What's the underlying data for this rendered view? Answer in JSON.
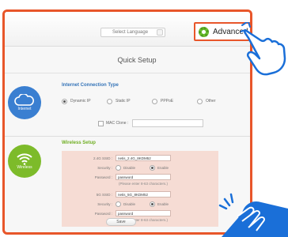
{
  "header": {
    "language_select": "Select Language",
    "advanced_label": "Advanced"
  },
  "page_title": "Quick Setup",
  "internet": {
    "icon_label": "Internet",
    "heading": "Internet Connection Type",
    "options": [
      "Dynamic IP",
      "Static IP",
      "PPPoE",
      "Other"
    ],
    "selected": "Dynamic IP",
    "mac_clone_label": "MAC Clone :"
  },
  "wireless": {
    "icon_label": "Wireless",
    "heading": "Wireless Setup",
    "ssid_24_label": "2.4G SSID :",
    "ssid_24_value": "netis_2.4G_8KDM52",
    "security_label": "Security :",
    "disable_label": "Disable",
    "enable_label": "Enable",
    "password_label": "Password :",
    "password_value": "password",
    "password_hint": "(Please enter 8-63 characters.)",
    "ssid_5_label": "5G SSID :",
    "ssid_5_value": "netis_5G_8KDM52",
    "security_5_label": "Security :",
    "password_5_label": "Password :",
    "password_5_value": "password",
    "password_5_hint": "(Please enter 8-63 characters.)"
  },
  "save_label": "Save",
  "colors": {
    "accent": "#e8562a",
    "internet_blue": "#3a7fd1",
    "wireless_green": "#7dbb2a",
    "hand_blue": "#1a6fd8"
  }
}
